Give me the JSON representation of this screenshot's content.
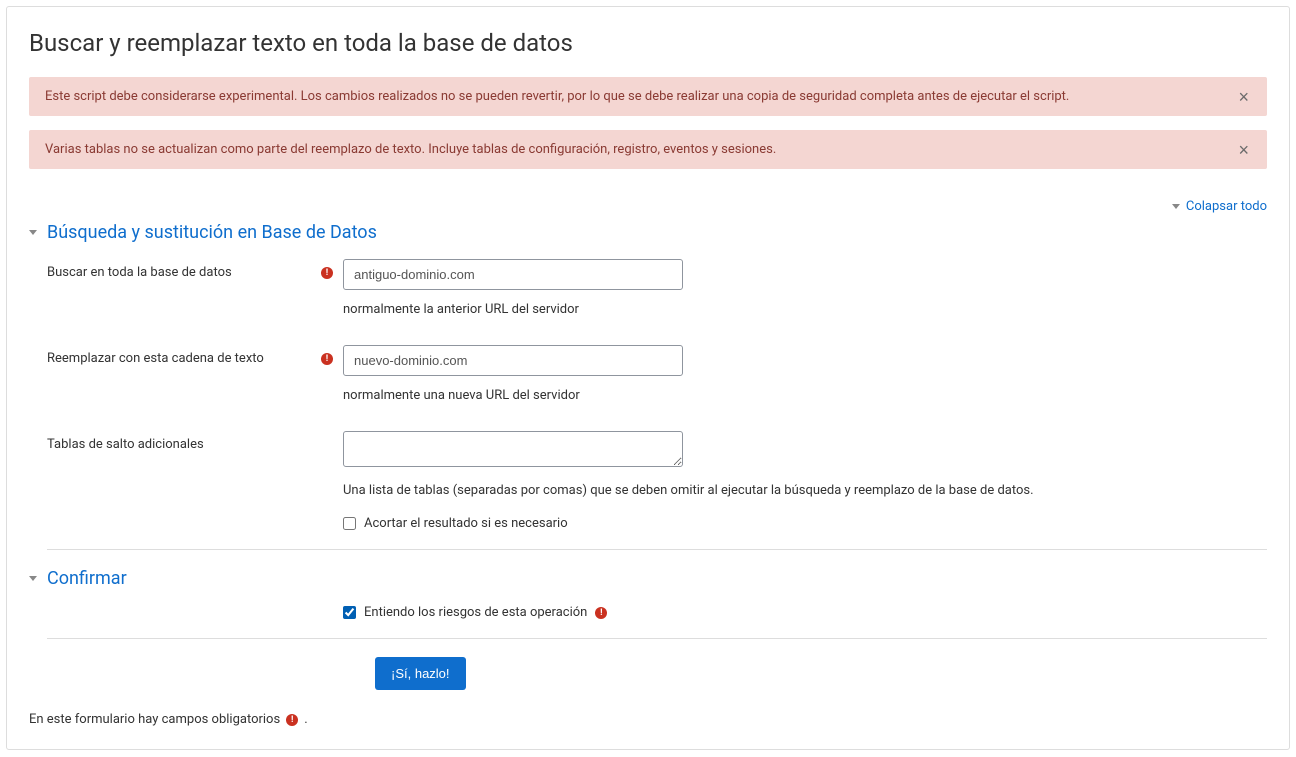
{
  "page": {
    "title": "Buscar y reemplazar texto en toda la base de datos"
  },
  "alerts": {
    "experimental": "Este script debe considerarse experimental. Los cambios realizados no se pueden revertir, por lo que se debe realizar una copia de seguridad completa antes de ejecutar el script.",
    "tablesSkipped": "Varias tablas no se actualizan como parte del reemplazo de texto. Incluye tablas de configuración, registro, eventos y sesiones."
  },
  "collapseAll": "Colapsar todo",
  "section1": {
    "title": "Búsqueda y sustitución en Base de Datos",
    "search": {
      "label": "Buscar en toda la base de datos",
      "value": "antiguo-dominio.com",
      "help": "normalmente la anterior URL del servidor"
    },
    "replace": {
      "label": "Reemplazar con esta cadena de texto",
      "value": "nuevo-dominio.com",
      "help": "normalmente una nueva URL del servidor"
    },
    "skipTables": {
      "label": "Tablas de salto adicionales",
      "value": "",
      "help": "Una lista de tablas (separadas por comas) que se deben omitir al ejecutar la búsqueda y reemplazo de la base de datos."
    },
    "shorten": {
      "label": "Acortar el resultado si es necesario"
    }
  },
  "section2": {
    "title": "Confirmar",
    "understand": {
      "label": "Entiendo los riesgos de esta operación"
    },
    "submit": "¡Sí, hazlo!"
  },
  "footer": {
    "required": "En este formulario hay campos obligatorios"
  }
}
